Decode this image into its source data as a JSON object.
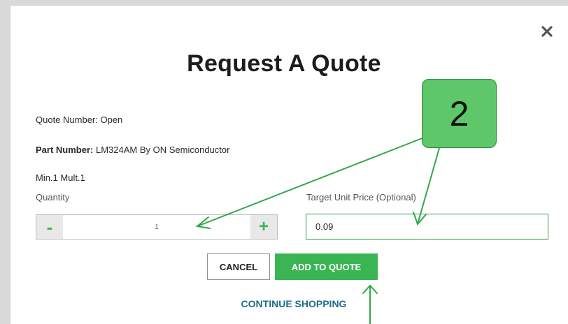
{
  "modal": {
    "title": "Request A Quote",
    "close_icon": "close-icon"
  },
  "info": {
    "quote_number": "Quote Number: Open",
    "part_number_label": "Part Number:",
    "part_number_value": "LM324AM By ON Semiconductor",
    "min_mult": "Min.1 Mult.1"
  },
  "quantity": {
    "label": "Quantity",
    "minus": "-",
    "plus": "+",
    "value": "1"
  },
  "target_price": {
    "label": "Target Unit Price (Optional)",
    "value": "0.09"
  },
  "actions": {
    "cancel": "CANCEL",
    "add_to_quote": "ADD TO QUOTE",
    "continue_shopping": "CONTINUE SHOPPING"
  },
  "annotation": {
    "callout_number": "2",
    "accent_color": "#3bb554",
    "arrow_color": "#2fa84a"
  }
}
